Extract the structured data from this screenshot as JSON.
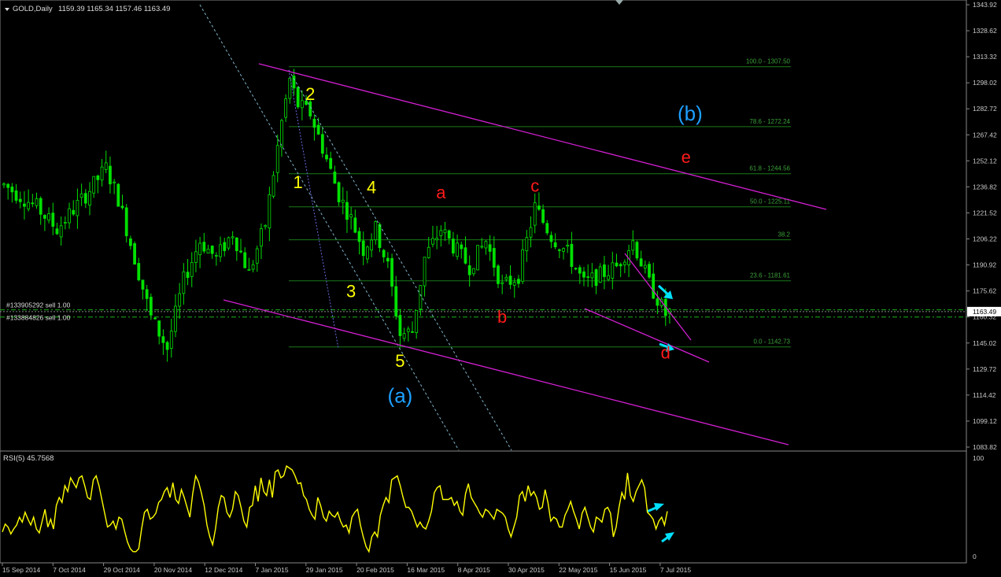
{
  "header": {
    "symbol": "GOLD,Daily",
    "ohlc": "1159.39 1165.34 1157.46 1163.49"
  },
  "colors": {
    "background": "#000000",
    "candle": "#00e000",
    "rsi_line": "#ffff00",
    "channel": "#d21fd2",
    "fib": "#1a7a1a",
    "wave_yellow": "#ffff00",
    "wave_red": "#ff1a1a",
    "wave_blue": "#1ea0ff",
    "arrow": "#00e0ff",
    "axis_text": "#c8c8c8"
  },
  "chart_data": [
    {
      "type": "candlestick",
      "title": "GOLD,Daily",
      "ylim": [
        1083.82,
        1343.92
      ],
      "y_ticks": [
        "1343.92",
        "1328.62",
        "1313.32",
        "1298.02",
        "1282.72",
        "1267.42",
        "1252.12",
        "1236.82",
        "1221.52",
        "1206.22",
        "1190.92",
        "1175.62",
        "1160.32",
        "1145.02",
        "1129.72",
        "1114.42",
        "1099.12",
        "1083.82"
      ],
      "x_ticks": [
        "15 Sep 2014",
        "7 Oct 2014",
        "29 Oct 2014",
        "20 Nov 2014",
        "12 Dec 2014",
        "7 Jan 2015",
        "29 Jan 2015",
        "20 Feb 2015",
        "16 Mar 2015",
        "8 Apr 2015",
        "30 Apr 2015",
        "22 May 2015",
        "15 Jun 2015",
        "7 Jul 2015"
      ],
      "current_price": "1163.49",
      "trade_lines": [
        {
          "label": "#133905292 sell 1.00",
          "price": 1164.5
        },
        {
          "label": "#133884826 sell 1.00",
          "price": 1160.3
        }
      ],
      "fib_levels": [
        {
          "label": "100.0 - 1307.50",
          "price": 1307.5
        },
        {
          "label": "78.6 - 1272.24",
          "price": 1272.24
        },
        {
          "label": "61.8 - 1244.56",
          "price": 1244.56
        },
        {
          "label": "50.0 - 1225.11",
          "price": 1225.11
        },
        {
          "label": "38.2",
          "price": 1205.7
        },
        {
          "label": "23.6 - 1181.61",
          "price": 1181.61
        },
        {
          "label": "0.0 - 1142.73",
          "price": 1142.73
        }
      ],
      "wave_labels": [
        {
          "text": "2",
          "color": "yellow",
          "bar": 75,
          "price": 1288
        },
        {
          "text": "1",
          "color": "yellow",
          "bar": 72,
          "price": 1236
        },
        {
          "text": "4",
          "color": "yellow",
          "bar": 90,
          "price": 1233
        },
        {
          "text": "3",
          "color": "yellow",
          "bar": 85,
          "price": 1172
        },
        {
          "text": "5",
          "color": "yellow",
          "bar": 97,
          "price": 1131
        },
        {
          "text": "(a)",
          "color": "blue",
          "bar": 97,
          "price": 1110
        },
        {
          "text": "a",
          "color": "red",
          "bar": 107,
          "price": 1230
        },
        {
          "text": "b",
          "color": "red",
          "bar": 122,
          "price": 1157
        },
        {
          "text": "c",
          "color": "red",
          "bar": 130,
          "price": 1234
        },
        {
          "text": "d",
          "color": "red",
          "bar": 162,
          "price": 1136
        },
        {
          "text": "(b)",
          "color": "blue",
          "bar": 168,
          "price": 1276
        },
        {
          "text": "e",
          "color": "red",
          "bar": 167,
          "price": 1251
        }
      ]
    },
    {
      "type": "line",
      "title": "RSI(5) 45.7568",
      "ylim": [
        0,
        100
      ],
      "y_ticks": [
        "100",
        "0"
      ],
      "series": [
        {
          "name": "RSI(5)",
          "values": [
            25,
            33,
            30,
            23,
            28,
            32,
            40,
            35,
            45,
            38,
            32,
            40,
            28,
            24,
            36,
            48,
            30,
            38,
            28,
            52,
            60,
            55,
            72,
            66,
            80,
            75,
            70,
            80,
            82,
            72,
            60,
            58,
            78,
            82,
            72,
            58,
            44,
            30,
            32,
            36,
            28,
            40,
            38,
            26,
            15,
            8,
            5,
            5,
            8,
            28,
            45,
            48,
            38,
            40,
            44,
            55,
            58,
            66,
            70,
            60,
            75,
            58,
            54,
            68,
            60,
            50,
            40,
            64,
            82,
            76,
            65,
            52,
            32,
            20,
            12,
            28,
            50,
            62,
            60,
            45,
            40,
            48,
            66,
            62,
            50,
            36,
            30,
            50,
            52,
            72,
            56,
            80,
            66,
            62,
            78,
            60,
            86,
            88,
            80,
            82,
            92,
            90,
            88,
            82,
            74,
            75,
            62,
            58,
            48,
            42,
            38,
            60,
            52,
            40,
            36,
            46,
            42,
            40,
            45,
            36,
            30,
            32,
            24,
            40,
            45,
            48,
            32,
            20,
            10,
            5,
            20,
            25,
            20,
            42,
            52,
            60,
            55,
            78,
            80,
            82,
            72,
            60,
            50,
            50,
            46,
            38,
            30,
            35,
            30,
            28,
            36,
            46,
            65,
            70,
            72,
            58,
            58,
            58,
            60,
            52,
            56,
            46,
            42,
            64,
            74,
            60,
            55,
            50,
            44,
            40,
            48,
            46,
            42,
            38,
            48,
            46,
            44,
            40,
            28,
            20,
            30,
            40,
            62,
            66,
            56,
            72,
            62,
            66,
            60,
            48,
            50,
            68,
            55,
            36,
            40,
            38,
            30,
            30,
            42,
            48,
            56,
            46,
            38,
            28,
            44,
            50,
            40,
            30,
            25,
            40,
            38,
            35,
            48,
            50,
            44,
            20,
            30,
            50,
            65,
            58,
            85,
            62,
            56,
            66,
            72,
            78,
            70,
            45,
            42,
            38,
            28,
            36,
            40,
            32,
            46
          ]
        }
      ]
    }
  ]
}
